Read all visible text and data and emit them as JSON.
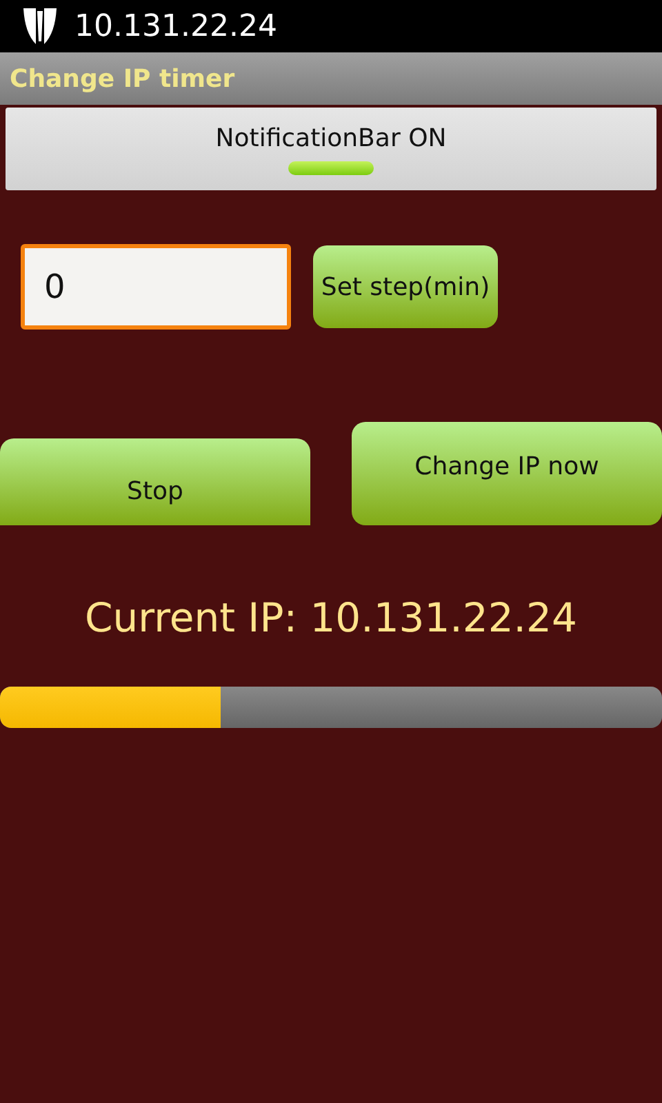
{
  "status_bar": {
    "text": "10.131.22.24"
  },
  "title_bar": {
    "title": "Change IP timer"
  },
  "notification_toggle": {
    "label": "NotificationBar ON",
    "on": true
  },
  "step_field": {
    "value": "0"
  },
  "set_step_button": "Set step(min)",
  "stop_button": "Stop",
  "change_ip_button": "Change IP now",
  "current_ip": "Current IP: 10.131.22.24",
  "progress": {
    "level": 0.333
  }
}
